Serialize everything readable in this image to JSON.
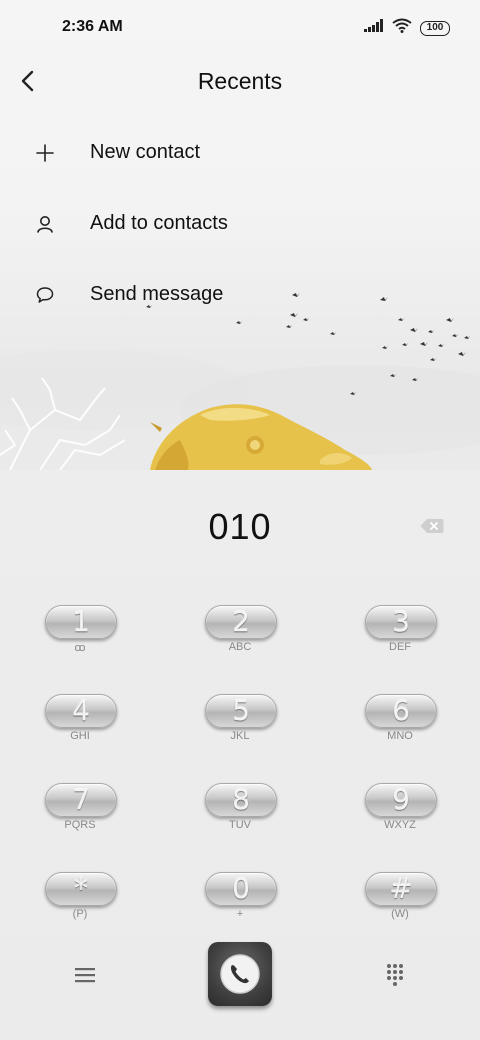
{
  "status_bar": {
    "time": "2:36 AM",
    "battery": "100",
    "signal_icon": "cellular-signal-icon",
    "wifi_icon": "wifi-icon"
  },
  "header": {
    "back_icon": "chevron-left-icon",
    "title": "Recents"
  },
  "menu": {
    "items": [
      {
        "icon": "plus-icon",
        "label": "New contact"
      },
      {
        "icon": "person-icon",
        "label": "Add to contacts"
      },
      {
        "icon": "message-bubble-icon",
        "label": "Send message"
      }
    ]
  },
  "dialer": {
    "number": "010",
    "backspace_icon": "backspace-icon",
    "keys": [
      {
        "digit": "1",
        "sub": "ꝏ"
      },
      {
        "digit": "2",
        "sub": "ABC"
      },
      {
        "digit": "3",
        "sub": "DEF"
      },
      {
        "digit": "4",
        "sub": "GHI"
      },
      {
        "digit": "5",
        "sub": "JKL"
      },
      {
        "digit": "6",
        "sub": "MNO"
      },
      {
        "digit": "7",
        "sub": "PQRS"
      },
      {
        "digit": "8",
        "sub": "TUV"
      },
      {
        "digit": "9",
        "sub": "WXYZ"
      },
      {
        "digit": "*",
        "sub": "(P)"
      },
      {
        "digit": "0",
        "sub": "+"
      },
      {
        "digit": "#",
        "sub": "(W)"
      }
    ]
  },
  "bottom_bar": {
    "menu_icon": "hamburger-menu-icon",
    "call_icon": "phone-call-icon",
    "keypad_icon": "keypad-grid-icon"
  }
}
